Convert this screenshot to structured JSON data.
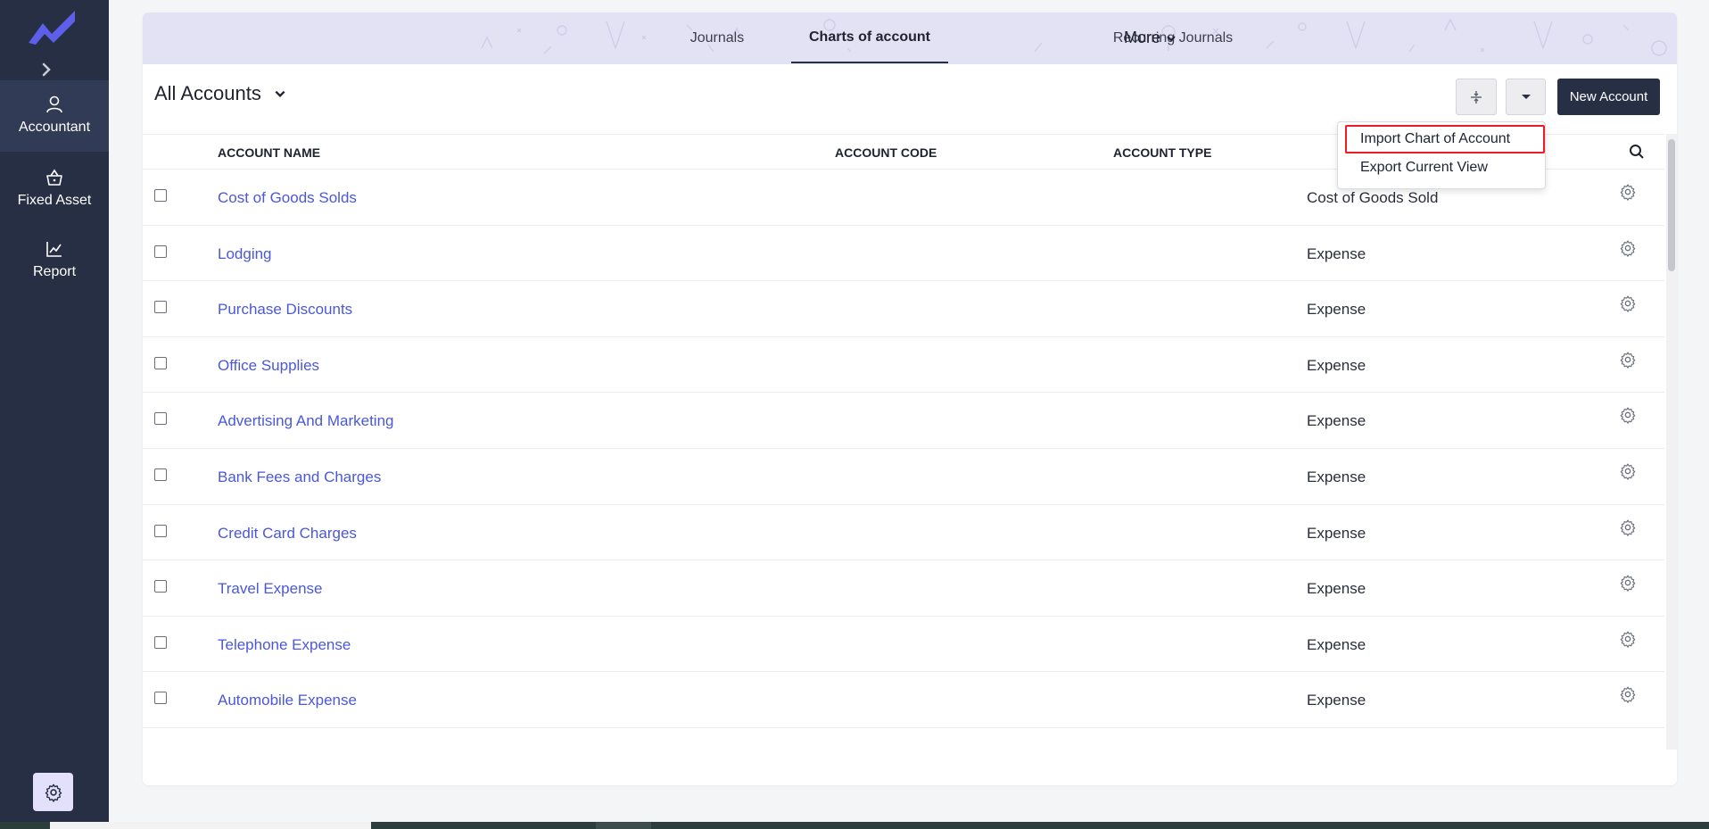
{
  "sidebar": {
    "items": [
      {
        "label": "Accountant",
        "icon": "user-icon",
        "active": true
      },
      {
        "label": "Fixed Asset",
        "icon": "basket-icon",
        "active": false
      },
      {
        "label": "Report",
        "icon": "chart-line-icon",
        "active": false
      }
    ]
  },
  "tabs": [
    {
      "label": "Journals",
      "active": false
    },
    {
      "label": "Charts of account",
      "active": true
    },
    {
      "label": "Recurring Journals",
      "active": false
    },
    {
      "label": "More",
      "active": false
    }
  ],
  "toolbar": {
    "view_label": "All Accounts",
    "new_account_label": "New Account"
  },
  "dropdown": {
    "items": [
      "Import Chart of Account",
      "Export Current View"
    ]
  },
  "table": {
    "headers": [
      "ACCOUNT NAME",
      "ACCOUNT CODE",
      "ACCOUNT TYPE"
    ],
    "rows": [
      {
        "name": "Cost of Goods Solds",
        "code": "",
        "type": "Cost of Goods Sold"
      },
      {
        "name": "Lodging",
        "code": "",
        "type": "Expense"
      },
      {
        "name": "Purchase Discounts",
        "code": "",
        "type": "Expense"
      },
      {
        "name": "Office Supplies",
        "code": "",
        "type": "Expense"
      },
      {
        "name": "Advertising And Marketing",
        "code": "",
        "type": "Expense"
      },
      {
        "name": "Bank Fees and Charges",
        "code": "",
        "type": "Expense"
      },
      {
        "name": "Credit Card Charges",
        "code": "",
        "type": "Expense"
      },
      {
        "name": "Travel Expense",
        "code": "",
        "type": "Expense"
      },
      {
        "name": "Telephone Expense",
        "code": "",
        "type": "Expense"
      },
      {
        "name": "Automobile Expense",
        "code": "",
        "type": "Expense"
      }
    ]
  },
  "colors": {
    "sidebar": "#272f45",
    "accent_link": "#4a58d9",
    "highlight": "#ec1c24",
    "tabbar": "#e3e2f4"
  }
}
